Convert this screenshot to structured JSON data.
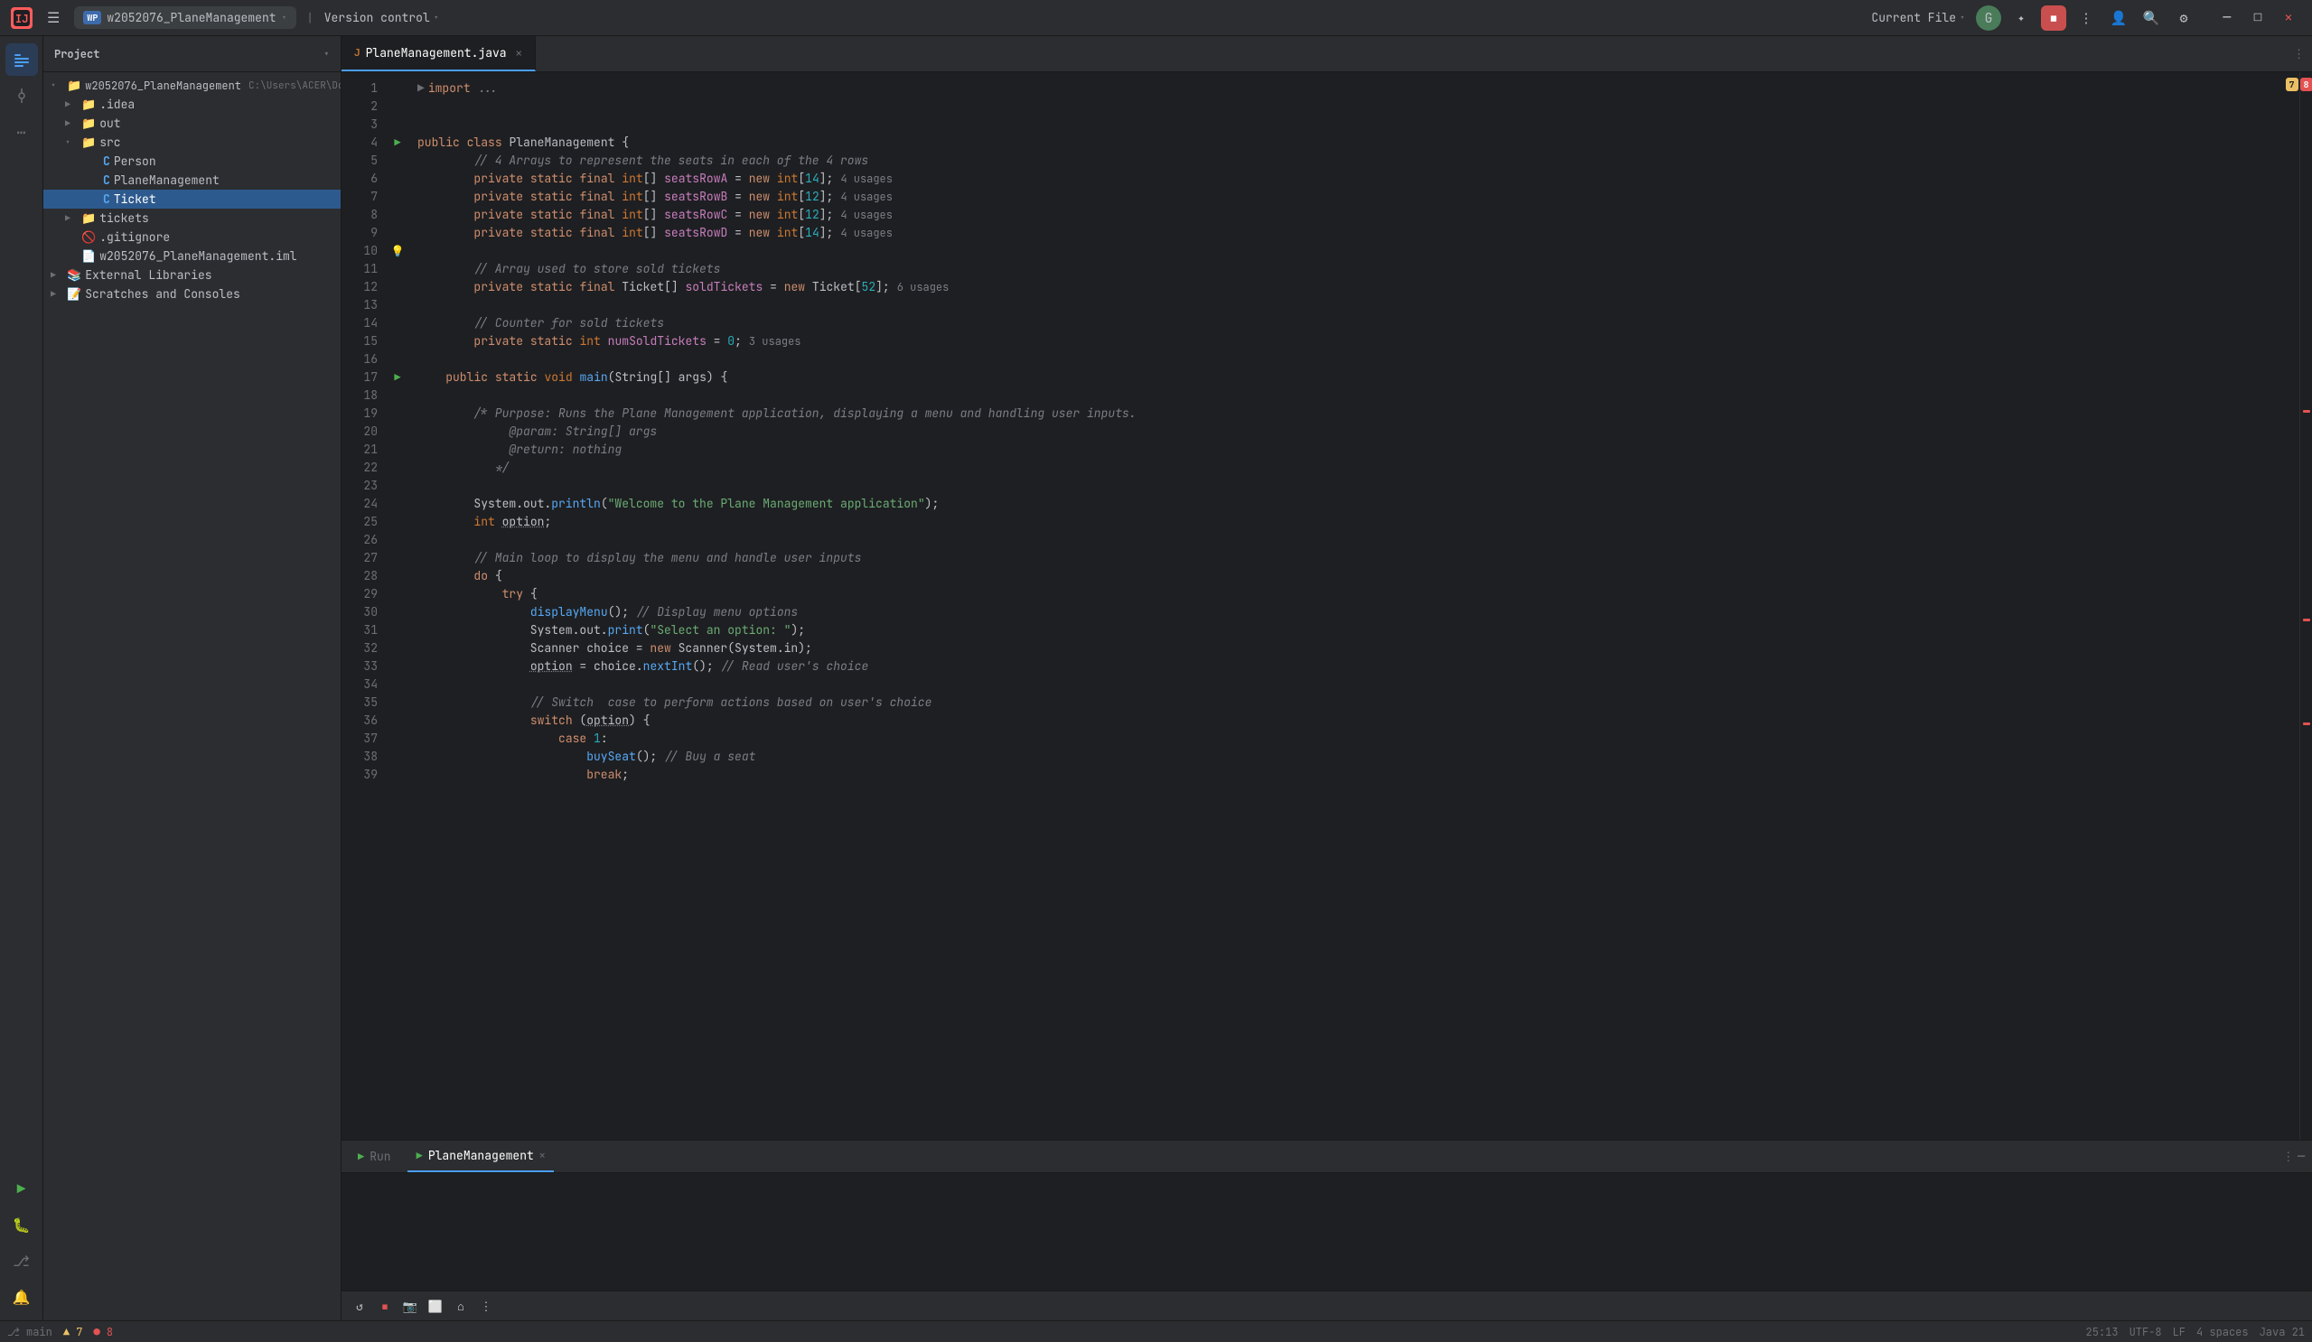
{
  "titlebar": {
    "logo": "IJ",
    "menu_icon": "☰",
    "project_wp": "WP",
    "project_name": "w2052076_PlaneManagement",
    "version_control": "Version control",
    "current_file": "Current File",
    "actions": {
      "profile": "👤",
      "search": "🔍",
      "settings": "⚙",
      "run_stop": "⏹",
      "more": "⋮"
    },
    "window_controls": {
      "minimize": "─",
      "maximize": "□",
      "close": "✕"
    }
  },
  "sidebar": {
    "project_label": "Project",
    "tree": [
      {
        "label": "w2052076_PlaneManagement",
        "type": "root",
        "depth": 0,
        "expanded": true,
        "path": "C:\\Users\\ACER\\Docu..."
      },
      {
        "label": ".idea",
        "type": "folder",
        "depth": 1,
        "expanded": false
      },
      {
        "label": "out",
        "type": "folder",
        "depth": 1,
        "expanded": false
      },
      {
        "label": "src",
        "type": "folder",
        "depth": 1,
        "expanded": true
      },
      {
        "label": "Person",
        "type": "java",
        "depth": 2
      },
      {
        "label": "PlaneManagement",
        "type": "java",
        "depth": 2
      },
      {
        "label": "Ticket",
        "type": "java",
        "depth": 2,
        "selected": true
      },
      {
        "label": "tickets",
        "type": "folder",
        "depth": 1,
        "expanded": false
      },
      {
        "label": ".gitignore",
        "type": "file",
        "depth": 1
      },
      {
        "label": "w2052076_PlaneManagement.iml",
        "type": "file",
        "depth": 1
      },
      {
        "label": "External Libraries",
        "type": "folder",
        "depth": 0,
        "expanded": false
      },
      {
        "label": "Scratches and Consoles",
        "type": "folder",
        "depth": 0,
        "expanded": false
      }
    ]
  },
  "editor": {
    "tab_name": "PlaneManagement.java",
    "warnings": "7",
    "errors": "8",
    "lines": [
      {
        "num": 1,
        "content": "import ...",
        "tokens": [
          {
            "text": "import ",
            "cls": "kw"
          },
          {
            "text": "...",
            "cls": "comment"
          }
        ],
        "collapsed": true
      },
      {
        "num": 2,
        "content": ""
      },
      {
        "num": 3,
        "content": ""
      },
      {
        "num": 4,
        "content": "public class PlaneManagement {",
        "tokens": [
          {
            "text": "public ",
            "cls": "kw"
          },
          {
            "text": "class ",
            "cls": "kw"
          },
          {
            "text": "PlaneManagement",
            "cls": ""
          },
          {
            "text": " {",
            "cls": ""
          }
        ],
        "runnable": true
      },
      {
        "num": 5,
        "content": "    // 4 Arrays to represent the seats in each of the 4 rows",
        "comment": true
      },
      {
        "num": 6,
        "content": "    private static final int[] seatsRowA = new int[14];  4 usages",
        "has_hint": true
      },
      {
        "num": 7,
        "content": "    private static final int[] seatsRowB = new int[12];  4 usages",
        "has_hint": true
      },
      {
        "num": 8,
        "content": "    private static final int[] seatsRowC = new int[12];  4 usages",
        "has_hint": true
      },
      {
        "num": 9,
        "content": "    private static final int[] seatsRowD = new int[14];  4 usages",
        "has_hint": true
      },
      {
        "num": 10,
        "content": ""
      },
      {
        "num": 11,
        "content": "    // Array used to store sold tickets",
        "comment": true
      },
      {
        "num": 12,
        "content": "    private static final Ticket[] soldTickets = new Ticket[52];  6 usages",
        "has_hint": true
      },
      {
        "num": 13,
        "content": ""
      },
      {
        "num": 14,
        "content": "    // Counter for sold tickets",
        "comment": true
      },
      {
        "num": 15,
        "content": "    private static int numSoldTickets = 0;  3 usages",
        "has_hint": true
      },
      {
        "num": 16,
        "content": ""
      },
      {
        "num": 17,
        "content": "    public static void main(String[] args) {",
        "runnable": true
      },
      {
        "num": 18,
        "content": ""
      },
      {
        "num": 19,
        "content": "        /* Purpose: Runs the Plane Management application, displaying a menu and handling user inputs."
      },
      {
        "num": 20,
        "content": "             @param: String[] args"
      },
      {
        "num": 21,
        "content": "             @return: nothing"
      },
      {
        "num": 22,
        "content": "           */"
      },
      {
        "num": 23,
        "content": ""
      },
      {
        "num": 24,
        "content": "        System.out.println(\"Welcome to the Plane Management application\");"
      },
      {
        "num": 25,
        "content": "        int option;"
      },
      {
        "num": 26,
        "content": ""
      },
      {
        "num": 27,
        "content": "        // Main loop to display the menu and handle user inputs",
        "comment": true
      },
      {
        "num": 28,
        "content": "        do {"
      },
      {
        "num": 29,
        "content": "            try {"
      },
      {
        "num": 30,
        "content": "                displayMenu(); // Display menu options"
      },
      {
        "num": 31,
        "content": "                System.out.print(\"Select an option: \");"
      },
      {
        "num": 32,
        "content": "                Scanner choice = new Scanner(System.in);"
      },
      {
        "num": 33,
        "content": "                option = choice.nextInt(); // Read user's choice"
      },
      {
        "num": 34,
        "content": ""
      },
      {
        "num": 35,
        "content": "                // Switch  case to perform actions based on user's choice",
        "comment": true
      },
      {
        "num": 36,
        "content": "                switch (option) {"
      },
      {
        "num": 37,
        "content": "                    case 1:"
      },
      {
        "num": 38,
        "content": "                        buySeat(); // Buy a seat"
      },
      {
        "num": 39,
        "content": "                        break;"
      }
    ]
  },
  "bottom_panel": {
    "tabs": [
      {
        "label": "Run",
        "icon": "▶",
        "active": false
      },
      {
        "label": "PlaneManagement",
        "icon": "▶",
        "active": true,
        "closable": true
      }
    ]
  },
  "status_bar": {
    "items": [
      "↺",
      "▶",
      "⏹",
      "📷",
      "⬜",
      "⌂",
      "⋮"
    ]
  }
}
